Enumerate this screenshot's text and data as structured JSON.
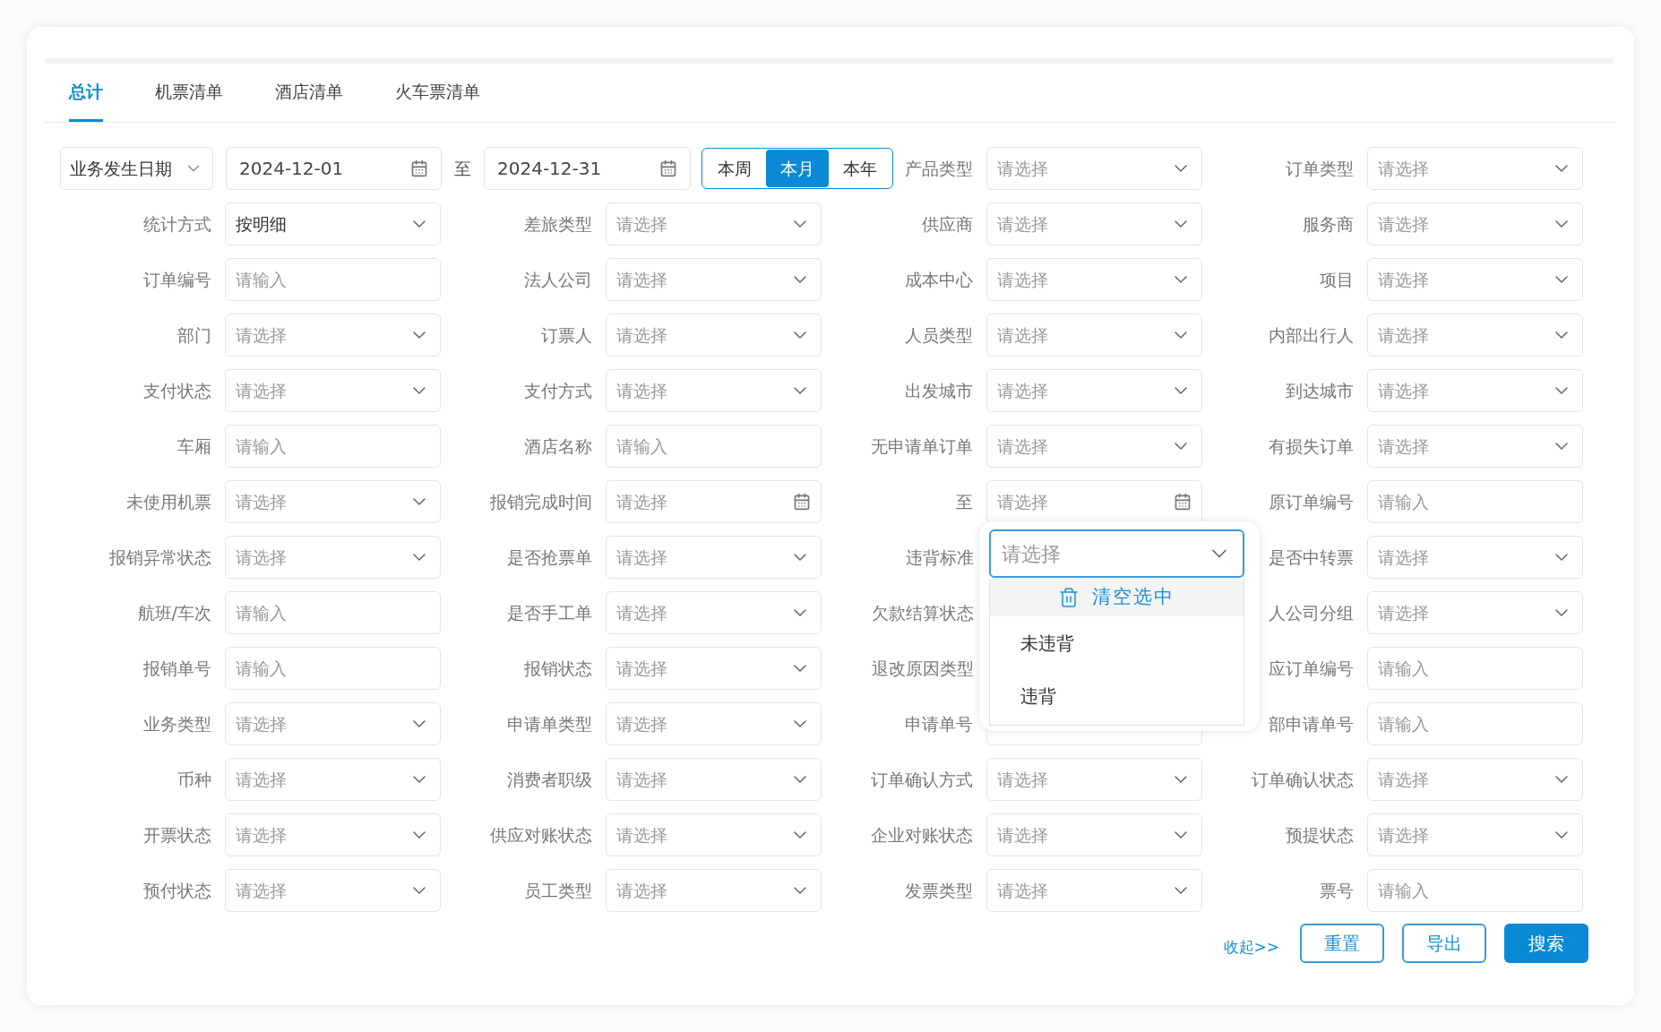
{
  "tabs": [
    {
      "label": "总计",
      "selected": true
    },
    {
      "label": "机票清单",
      "selected": false
    },
    {
      "label": "酒店清单",
      "selected": false
    },
    {
      "label": "火车票清单",
      "selected": false
    }
  ],
  "date_filter": {
    "type": "业务发生日期",
    "start": "2024-12-01",
    "separator": "至",
    "end": "2024-12-31",
    "presets": [
      {
        "label": "本周",
        "selected": false
      },
      {
        "label": "本月",
        "selected": true
      },
      {
        "label": "本年",
        "selected": false
      }
    ]
  },
  "fields": [
    {
      "label": "产品类型",
      "kind": "select",
      "placeholder": "请选择"
    },
    {
      "label": "订单类型",
      "kind": "select",
      "placeholder": "请选择"
    },
    {
      "label": "统计方式",
      "kind": "select",
      "value": "按明细"
    },
    {
      "label": "差旅类型",
      "kind": "select",
      "placeholder": "请选择"
    },
    {
      "label": "供应商",
      "kind": "select",
      "placeholder": "请选择"
    },
    {
      "label": "服务商",
      "kind": "select",
      "placeholder": "请选择"
    },
    {
      "label": "订单编号",
      "kind": "input",
      "placeholder": "请输入"
    },
    {
      "label": "法人公司",
      "kind": "select",
      "placeholder": "请选择"
    },
    {
      "label": "成本中心",
      "kind": "select",
      "placeholder": "请选择"
    },
    {
      "label": "项目",
      "kind": "select",
      "placeholder": "请选择"
    },
    {
      "label": "部门",
      "kind": "select",
      "placeholder": "请选择"
    },
    {
      "label": "订票人",
      "kind": "select",
      "placeholder": "请选择"
    },
    {
      "label": "人员类型",
      "kind": "select",
      "placeholder": "请选择"
    },
    {
      "label": "内部出行人",
      "kind": "select",
      "placeholder": "请选择"
    },
    {
      "label": "支付状态",
      "kind": "select",
      "placeholder": "请选择"
    },
    {
      "label": "支付方式",
      "kind": "select",
      "placeholder": "请选择"
    },
    {
      "label": "出发城市",
      "kind": "select",
      "placeholder": "请选择"
    },
    {
      "label": "到达城市",
      "kind": "select",
      "placeholder": "请选择"
    },
    {
      "label": "车厢",
      "kind": "input",
      "placeholder": "请输入"
    },
    {
      "label": "酒店名称",
      "kind": "input",
      "placeholder": "请输入"
    },
    {
      "label": "无申请单订单",
      "kind": "select",
      "placeholder": "请选择"
    },
    {
      "label": "有损失订单",
      "kind": "select",
      "placeholder": "请选择"
    },
    {
      "label": "未使用机票",
      "kind": "select",
      "placeholder": "请选择"
    },
    {
      "label": "报销完成时间",
      "kind": "date",
      "placeholder": "请选择"
    },
    {
      "label": "至",
      "kind": "date",
      "placeholder": "请选择"
    },
    {
      "label": "原订单编号",
      "kind": "input",
      "placeholder": "请输入"
    },
    {
      "label": "报销异常状态",
      "kind": "select",
      "placeholder": "请选择"
    },
    {
      "label": "是否抢票单",
      "kind": "select",
      "placeholder": "请选择"
    },
    {
      "label": "违背标准",
      "kind": "select",
      "placeholder": "请选择",
      "open": true,
      "menu": [
        {
          "kind": "clear",
          "label": "清空选中"
        },
        {
          "kind": "option",
          "label": "未违背"
        },
        {
          "kind": "option",
          "label": "违背"
        }
      ]
    },
    {
      "label": "是否中转票",
      "kind": "select",
      "placeholder": "请选择"
    },
    {
      "label": "航班/车次",
      "kind": "input",
      "placeholder": "请输入"
    },
    {
      "label": "是否手工单",
      "kind": "select",
      "placeholder": "请选择"
    },
    {
      "label": "欠款结算状态",
      "kind": "covered"
    },
    {
      "label": "人公司分组",
      "kind": "select",
      "placeholder": "请选择"
    },
    {
      "label": "报销单号",
      "kind": "input",
      "placeholder": "请输入"
    },
    {
      "label": "报销状态",
      "kind": "select",
      "placeholder": "请选择"
    },
    {
      "label": "退改原因类型",
      "kind": "covered"
    },
    {
      "label": "应订单编号",
      "kind": "input",
      "placeholder": "请输入"
    },
    {
      "label": "业务类型",
      "kind": "select",
      "placeholder": "请选择"
    },
    {
      "label": "申请单类型",
      "kind": "select",
      "placeholder": "请选择"
    },
    {
      "label": "申请单号",
      "kind": "blank"
    },
    {
      "label": "部申请单号",
      "kind": "input",
      "placeholder": "请输入"
    },
    {
      "label": "币种",
      "kind": "select",
      "placeholder": "请选择"
    },
    {
      "label": "消费者职级",
      "kind": "select",
      "placeholder": "请选择"
    },
    {
      "label": "订单确认方式",
      "kind": "select",
      "placeholder": "请选择"
    },
    {
      "label": "订单确认状态",
      "kind": "select",
      "placeholder": "请选择"
    },
    {
      "label": "开票状态",
      "kind": "select",
      "placeholder": "请选择"
    },
    {
      "label": "供应对账状态",
      "kind": "select",
      "placeholder": "请选择"
    },
    {
      "label": "企业对账状态",
      "kind": "select",
      "placeholder": "请选择"
    },
    {
      "label": "预提状态",
      "kind": "select",
      "placeholder": "请选择"
    },
    {
      "label": "预付状态",
      "kind": "select",
      "placeholder": "请选择"
    },
    {
      "label": "员工类型",
      "kind": "select",
      "placeholder": "请选择"
    },
    {
      "label": "发票类型",
      "kind": "select",
      "placeholder": "请选择"
    },
    {
      "label": "票号",
      "kind": "input",
      "placeholder": "请输入"
    }
  ],
  "footer": {
    "collapse_link": "收起>>",
    "buttons": [
      {
        "label": "重置",
        "kind": "outline"
      },
      {
        "label": "导出",
        "kind": "outline"
      },
      {
        "label": "搜索",
        "kind": "primary"
      }
    ]
  }
}
